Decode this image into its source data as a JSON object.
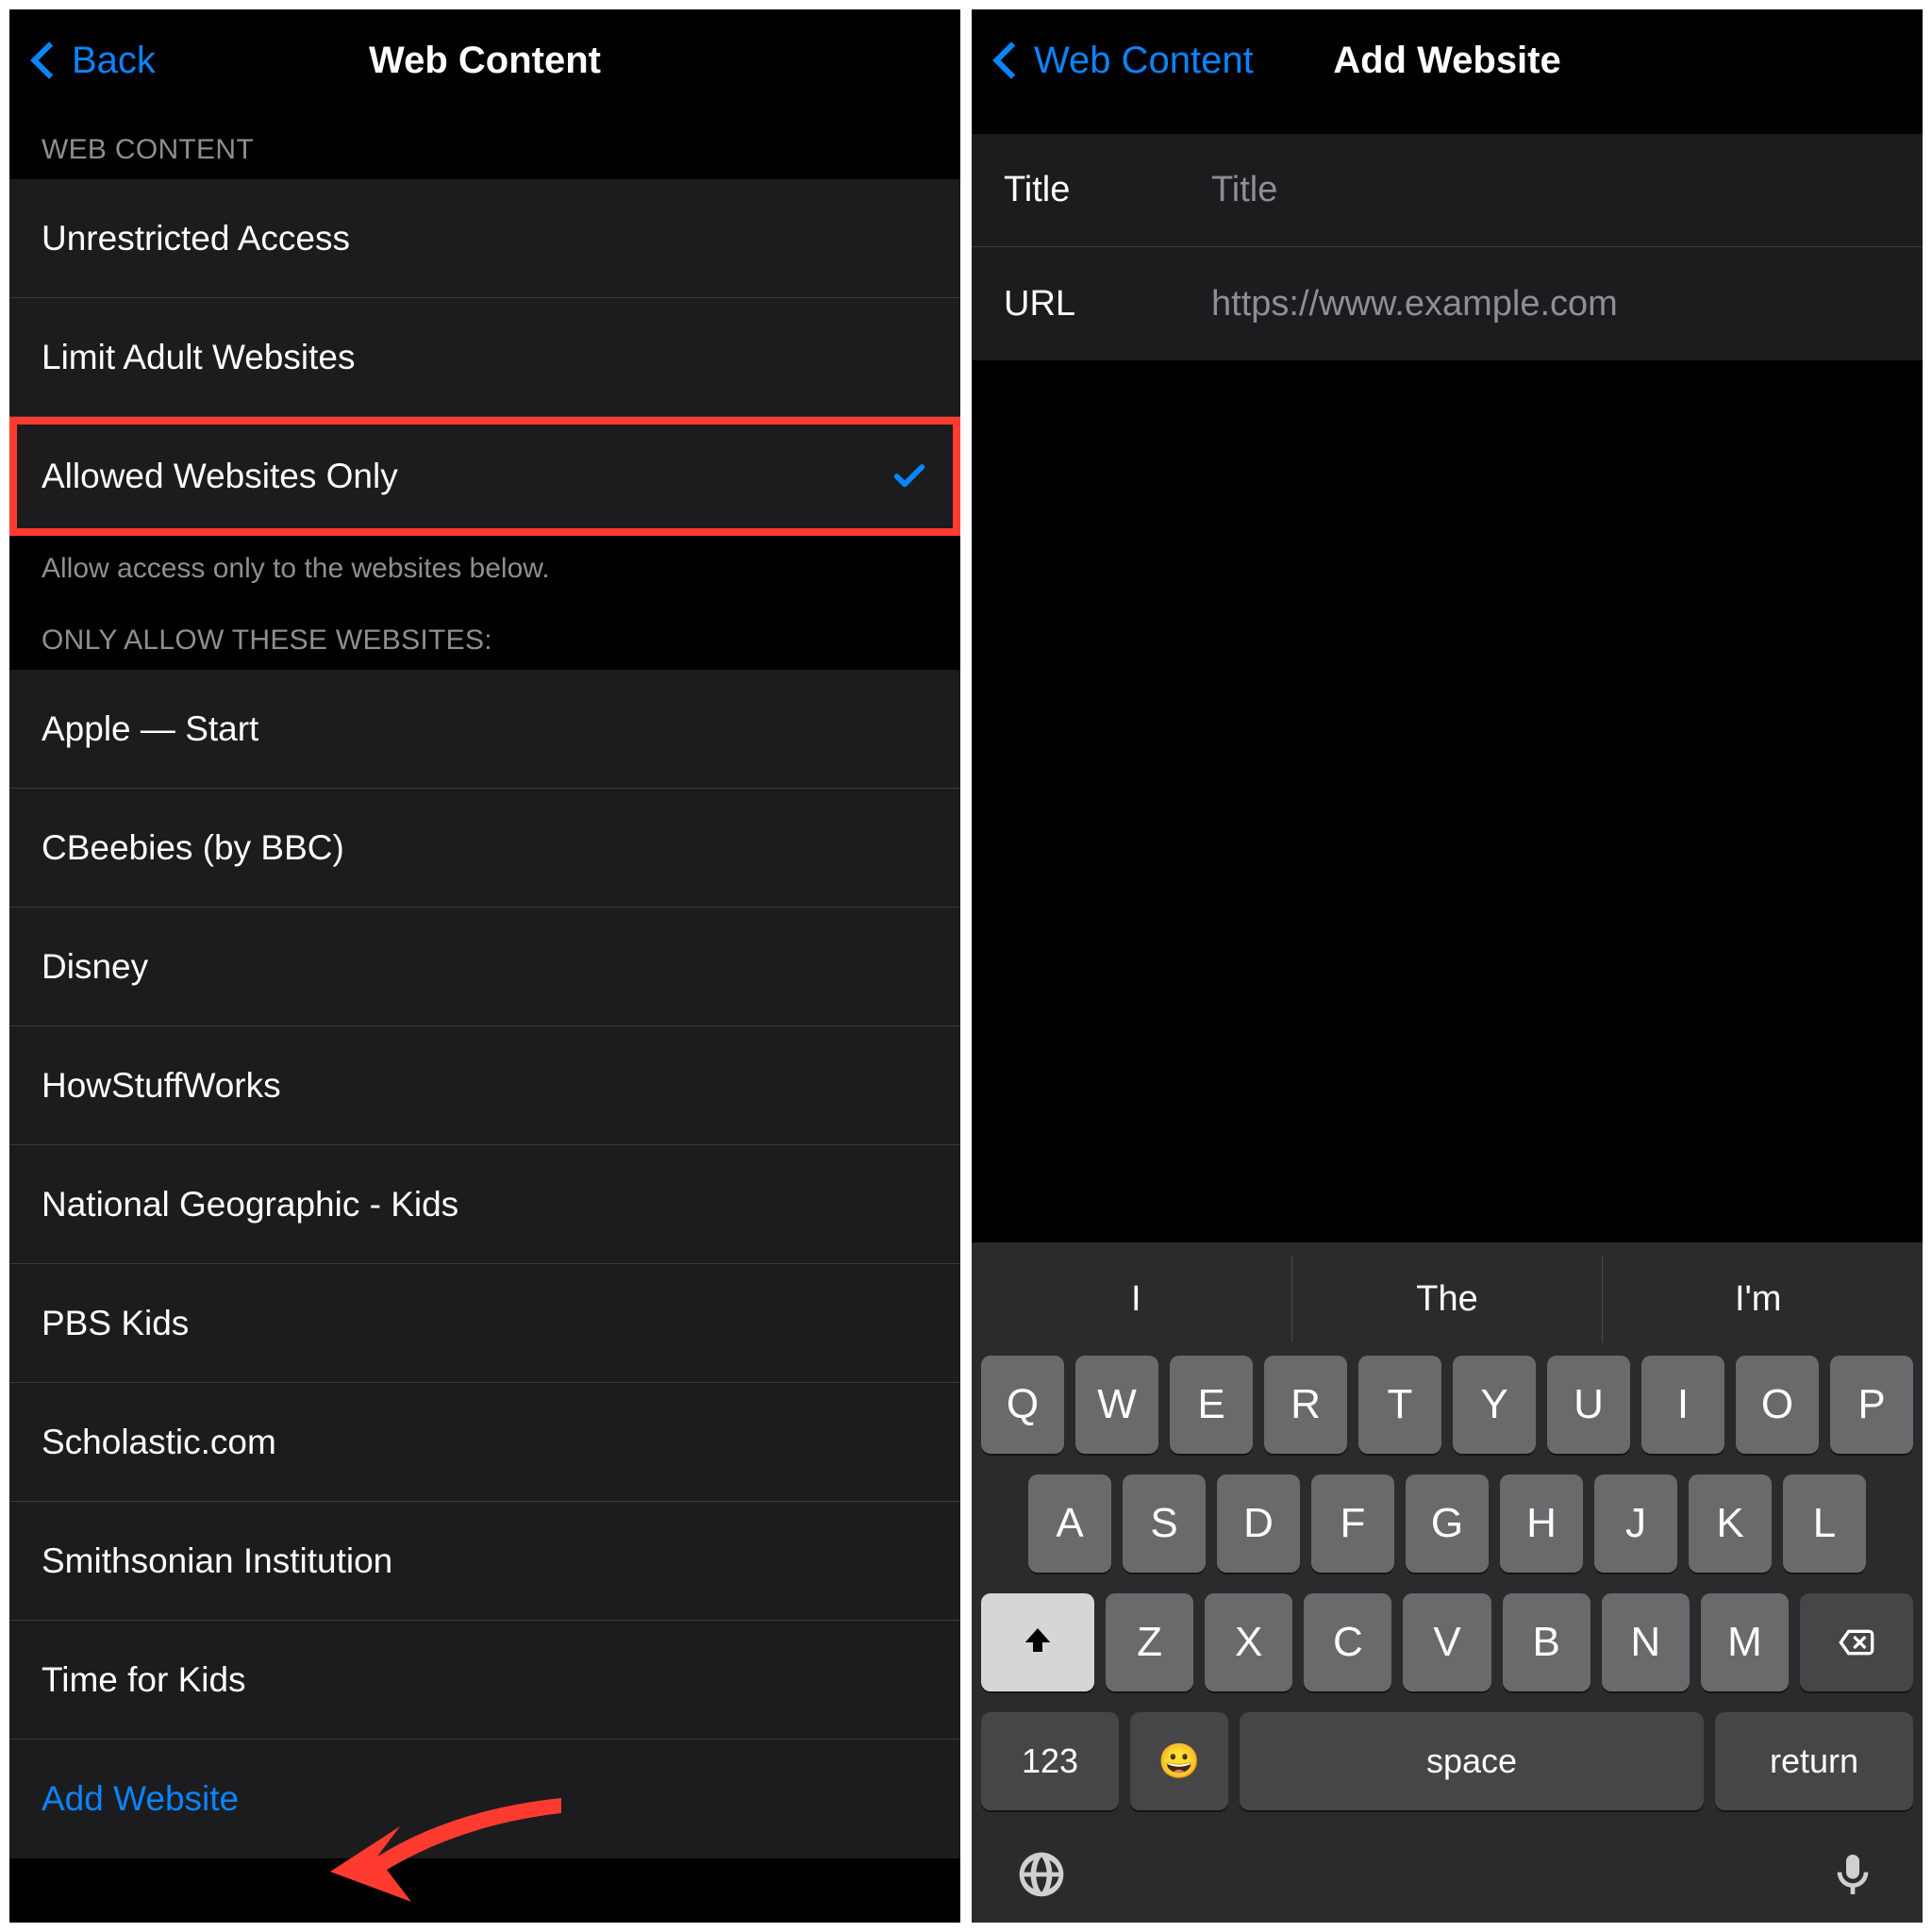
{
  "left": {
    "back_label": "Back",
    "title": "Web Content",
    "section_web_content": "WEB CONTENT",
    "options": [
      {
        "label": "Unrestricted Access",
        "checked": false
      },
      {
        "label": "Limit Adult Websites",
        "checked": false
      },
      {
        "label": "Allowed Websites Only",
        "checked": true,
        "highlighted": true
      }
    ],
    "footer_text": "Allow access only to the websites below.",
    "section_allowlist": "ONLY ALLOW THESE WEBSITES:",
    "allowed_sites": [
      "Apple — Start",
      "CBeebies (by BBC)",
      "Disney",
      "HowStuffWorks",
      "National Geographic - Kids",
      "PBS Kids",
      "Scholastic.com",
      "Smithsonian Institution",
      "Time for Kids"
    ],
    "add_label": "Add Website"
  },
  "right": {
    "back_label": "Web Content",
    "title": "Add Website",
    "fields": {
      "title_label": "Title",
      "title_placeholder": "Title",
      "url_label": "URL",
      "url_placeholder": "https://www.example.com"
    },
    "keyboard": {
      "predictions": [
        "I",
        "The",
        "I'm"
      ],
      "row1": [
        "Q",
        "W",
        "E",
        "R",
        "T",
        "Y",
        "U",
        "I",
        "O",
        "P"
      ],
      "row2": [
        "A",
        "S",
        "D",
        "F",
        "G",
        "H",
        "J",
        "K",
        "L"
      ],
      "row3": [
        "Z",
        "X",
        "C",
        "V",
        "B",
        "N",
        "M"
      ],
      "n123": "123",
      "space": "space",
      "return": "return"
    }
  }
}
